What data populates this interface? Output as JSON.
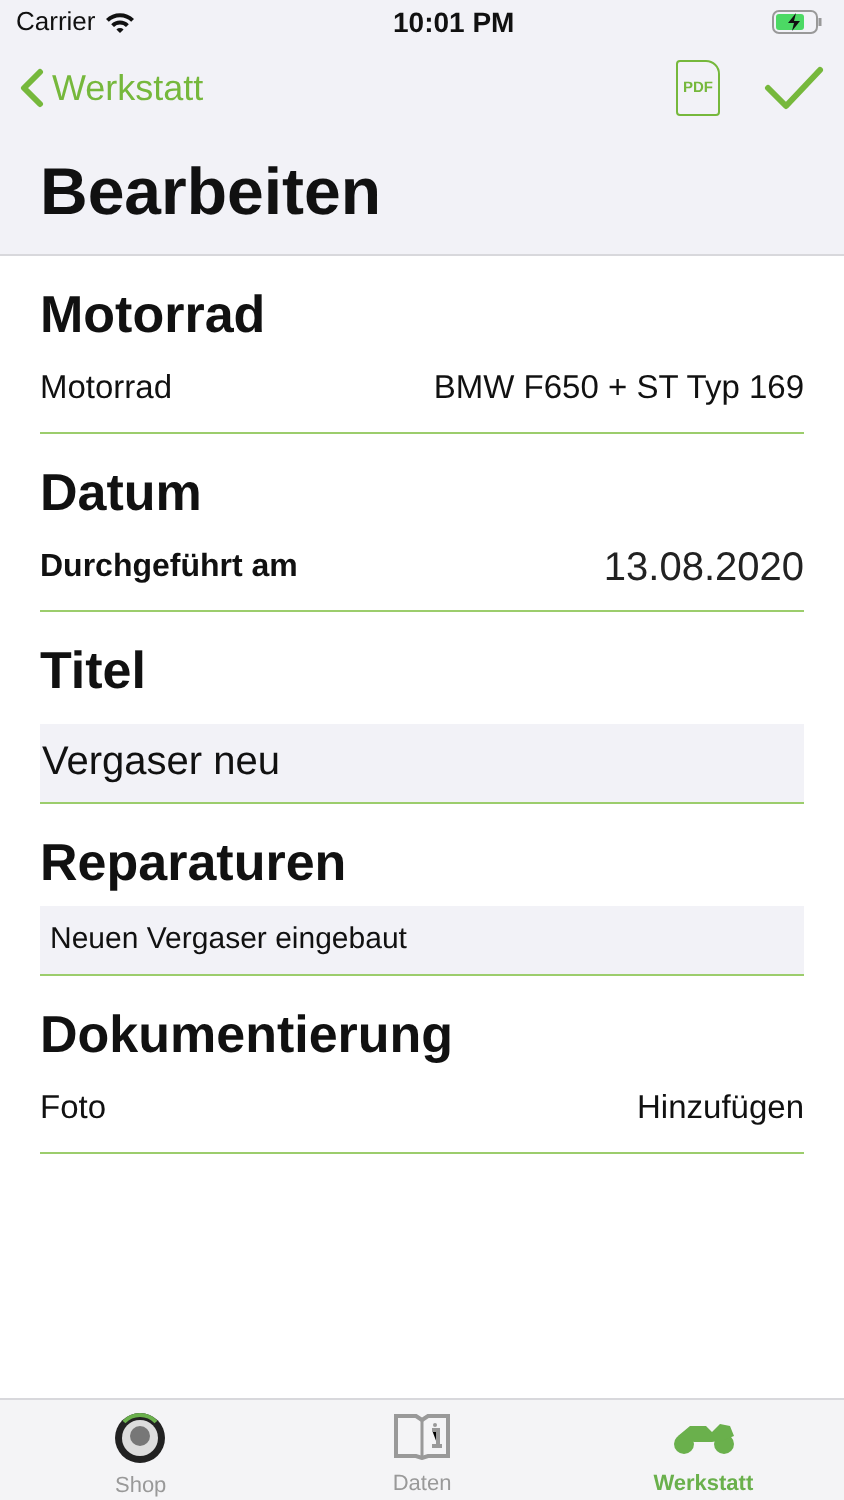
{
  "status_bar": {
    "carrier": "Carrier",
    "time": "10:01 PM"
  },
  "nav": {
    "back": "Werkstatt",
    "pdf": "PDF"
  },
  "title": "Bearbeiten",
  "sections": [
    {
      "heading": "Motorrad",
      "kind": "picker",
      "label": "Motorrad",
      "value": "BMW F650 + ST Typ 169"
    },
    {
      "heading": "Datum",
      "kind": "date",
      "label": "Durchgeführt am",
      "value": "13.08.2020"
    },
    {
      "heading": "Titel",
      "kind": "text",
      "value": "Vergaser neu"
    },
    {
      "heading": "Reparaturen",
      "kind": "note",
      "value": "Neuen Vergaser eingebaut"
    },
    {
      "heading": "Dokumentierung",
      "kind": "action",
      "label": "Foto",
      "value": "Hinzufügen"
    }
  ],
  "tabs": [
    {
      "label": "Shop",
      "kind": "badge",
      "selected": false
    },
    {
      "label": "Daten",
      "kind": "book",
      "selected": false
    },
    {
      "label": "Werkstatt",
      "kind": "moto",
      "selected": true
    }
  ]
}
